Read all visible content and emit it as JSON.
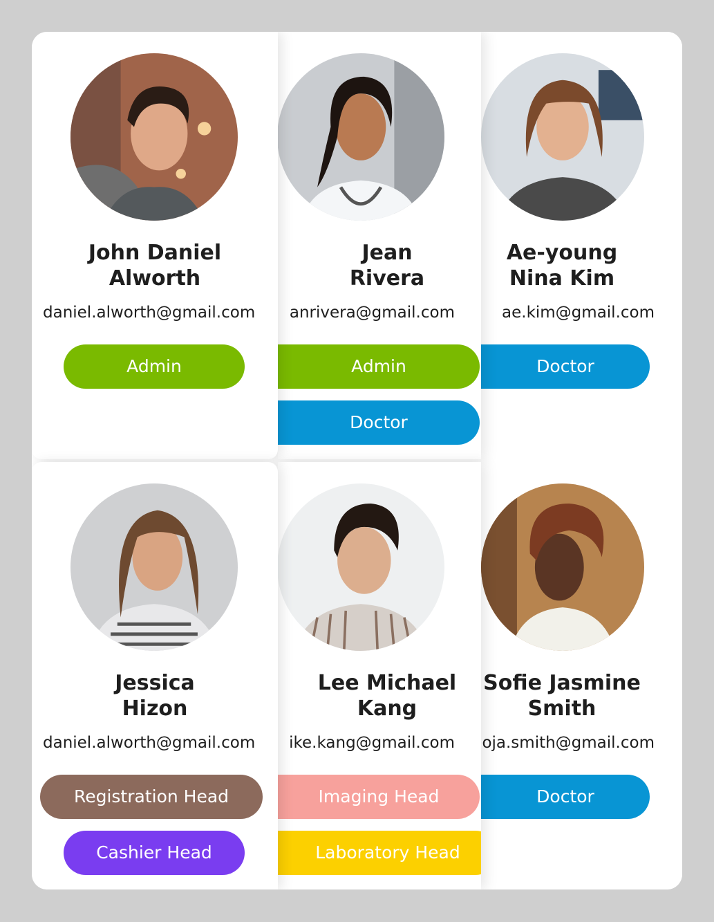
{
  "colors": {
    "admin": "#7aba00",
    "doctor": "#0895d4",
    "registration_head": "#8c6a5c",
    "cashier_head": "#7a3df0",
    "imaging_head": "#f7a19c",
    "laboratory_head": "#fcd000"
  },
  "users": [
    {
      "name_line1": "John Daniel",
      "name_line2": "Alworth",
      "email": "daniel.alworth@gmail.com",
      "roles": [
        "Admin"
      ]
    },
    {
      "name_line1": "Jean",
      "name_line2": "Rivera",
      "email": "anrivera@gmail.com",
      "roles": [
        "Admin",
        "Doctor"
      ]
    },
    {
      "name_line1": "Ae-young",
      "name_line2": "Nina Kim",
      "email": "ae.kim@gmail.com",
      "roles": [
        "Doctor"
      ]
    },
    {
      "name_line1": "Jessica",
      "name_line2": "Hizon",
      "email": "daniel.alworth@gmail.com",
      "roles": [
        "Registration Head",
        "Cashier Head"
      ]
    },
    {
      "name_line1": "Lee Michael",
      "name_line2": "Kang",
      "email": "ike.kang@gmail.com",
      "roles": [
        "Imaging Head",
        "Laboratory Head"
      ]
    },
    {
      "name_line1": "Sofie Jasmine",
      "name_line2": "Smith",
      "email": "oja.smith@gmail.com",
      "roles": [
        "Doctor"
      ]
    }
  ]
}
